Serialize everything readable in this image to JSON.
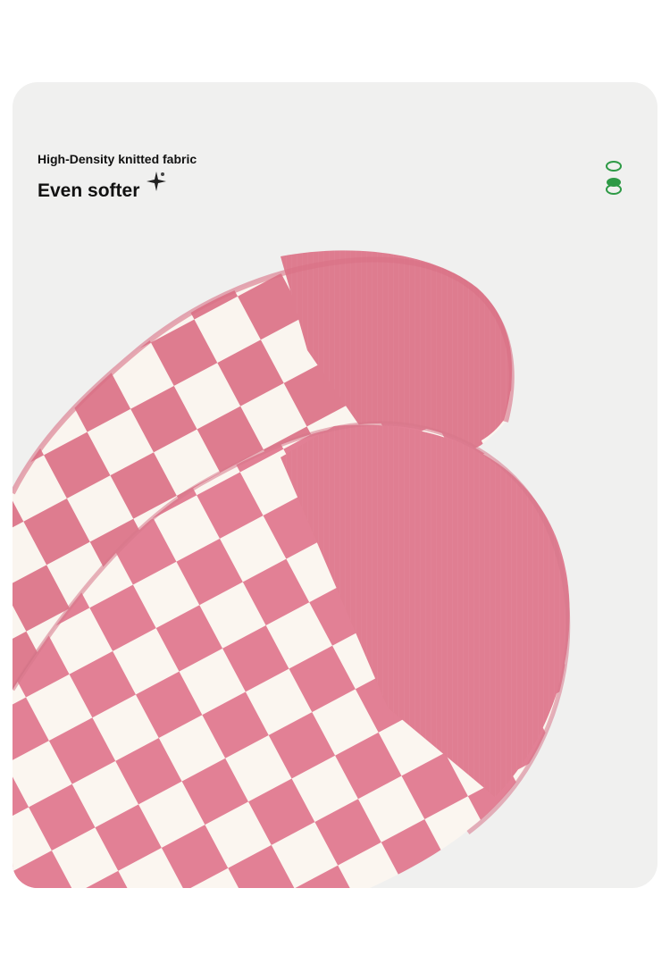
{
  "text": {
    "subtitle": "High-Density knitted fabric",
    "headline": "Even softer"
  },
  "colors": {
    "card_background": "#f0f0ef",
    "sock_pink": "#de7c8f",
    "sock_cream": "#faf5ef",
    "accent_green": "#2e9a46",
    "text": "#111111"
  },
  "icons": {
    "sparkle": "sparkle-icon",
    "rings": "green-rings-icon"
  },
  "image": {
    "subject": "checkered-pink-white-socks"
  }
}
